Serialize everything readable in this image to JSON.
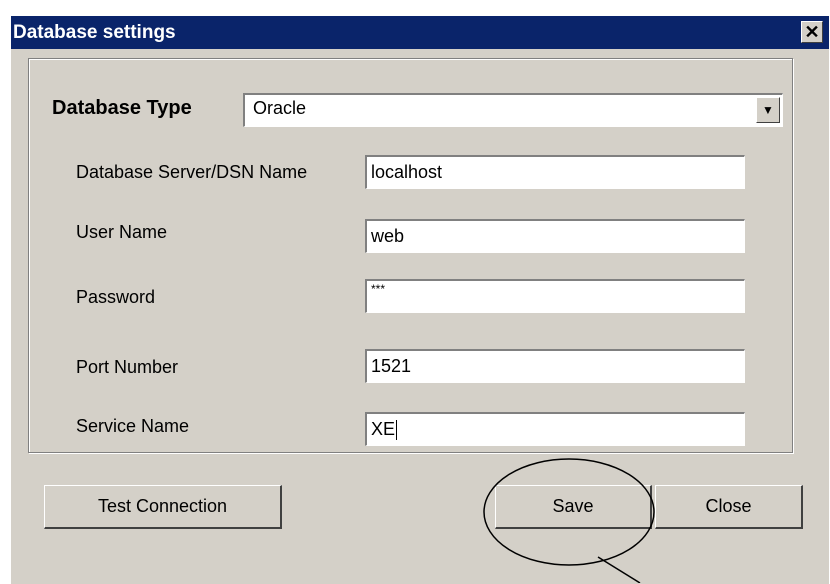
{
  "window": {
    "title": "Database settings",
    "close_glyph": "✕",
    "close_icon": "close-icon"
  },
  "form": {
    "db_type_label": "Database Type",
    "db_type_value": "Oracle",
    "dropdown_icon": "chevron-down-icon",
    "server_label": "Database Server/DSN Name",
    "server_value": "localhost",
    "username_label": "User Name",
    "username_value": "web",
    "password_label": "Password",
    "password_value": "***",
    "port_label": "Port Number",
    "port_value": "1521",
    "service_label": "Service Name",
    "service_value": "XE"
  },
  "buttons": {
    "test_connection": "Test Connection",
    "save": "Save",
    "close": "Close"
  },
  "colors": {
    "titlebar": "#0a246a",
    "face": "#d4d0c8"
  }
}
